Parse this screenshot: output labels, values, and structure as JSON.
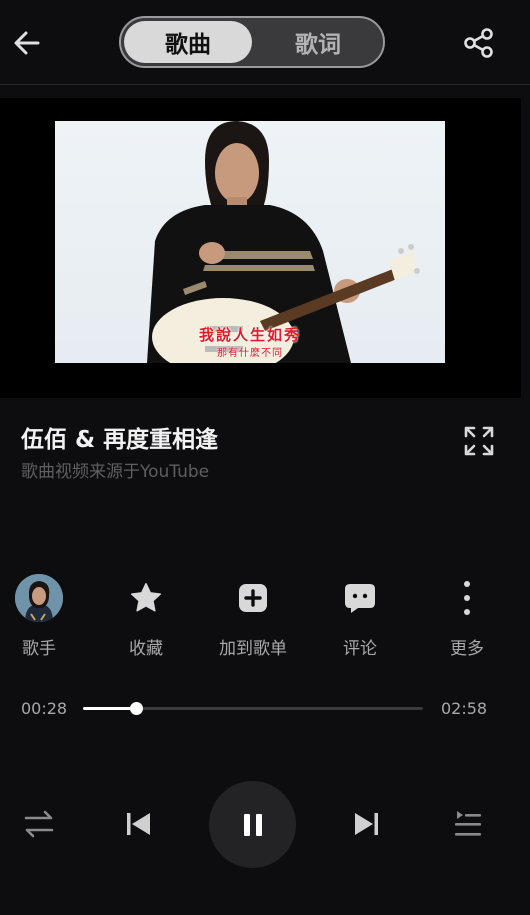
{
  "header": {
    "tab_song": "歌曲",
    "tab_lyrics": "歌词",
    "back_icon": "arrow-left-icon",
    "share_icon": "share-icon"
  },
  "video": {
    "subtitle_main": "我說人生如秀",
    "subtitle_sub": "那有什麼不同"
  },
  "song": {
    "title": "伍佰 &  再度重相逢",
    "source": "歌曲视频来源于YouTube",
    "expand_icon": "fullscreen-expand-icon"
  },
  "actions": [
    {
      "label": "歌手",
      "icon": "artist-avatar"
    },
    {
      "label": "收藏",
      "icon": "star-icon"
    },
    {
      "label": "加到歌单",
      "icon": "add-playlist-icon"
    },
    {
      "label": "评论",
      "icon": "comment-icon"
    },
    {
      "label": "更多",
      "icon": "more-vertical-icon"
    }
  ],
  "progress": {
    "current": "00:28",
    "total": "02:58",
    "fraction": 0.157
  },
  "controls": {
    "mode_icon": "repeat-shuffle-icon",
    "prev_icon": "skip-previous-icon",
    "play_icon": "pause-icon",
    "next_icon": "skip-next-icon",
    "playlist_icon": "queue-list-icon"
  },
  "colors": {
    "background": "#0d0d0f",
    "accent": "#ffffff",
    "muted_text": "#a8a8ab"
  }
}
